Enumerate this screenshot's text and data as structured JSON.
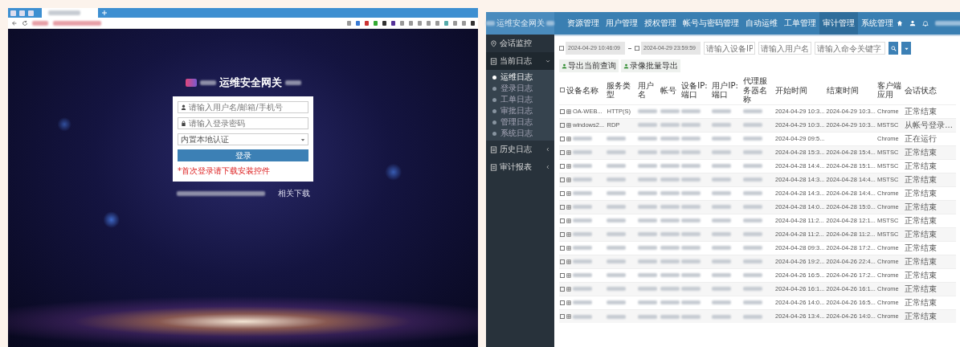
{
  "login_page": {
    "title": "运维安全网关",
    "username": {
      "placeholder": "请输入用户名/邮箱/手机号"
    },
    "password": {
      "placeholder": "请输入登录密码"
    },
    "auth_method": {
      "value": "内置本地认证"
    },
    "login_button": "登录",
    "notice": "*首次登录请下载安装控件",
    "download_link": "相关下载"
  },
  "app": {
    "brand": "运维安全网关",
    "menu": [
      {
        "label": "资源管理",
        "selected": false
      },
      {
        "label": "用户管理",
        "selected": false
      },
      {
        "label": "授权管理",
        "selected": false
      },
      {
        "label": "帐号与密码管理",
        "selected": false
      },
      {
        "label": "自动运维",
        "selected": false
      },
      {
        "label": "工单管理",
        "selected": false
      },
      {
        "label": "审计管理",
        "selected": true
      },
      {
        "label": "系统管理",
        "selected": false
      }
    ],
    "sidebar": [
      {
        "kind": "link",
        "label": "会话监控"
      },
      {
        "kind": "group",
        "label": "当前日志",
        "expanded": true,
        "children": [
          {
            "label": "运维日志",
            "selected": true
          },
          {
            "label": "登录日志",
            "selected": false
          },
          {
            "label": "工单日志",
            "selected": false
          },
          {
            "label": "审批日志",
            "selected": false
          },
          {
            "label": "管理日志",
            "selected": false
          },
          {
            "label": "系统日志",
            "selected": false
          }
        ]
      },
      {
        "kind": "group",
        "label": "历史日志",
        "expanded": false
      },
      {
        "kind": "group",
        "label": "审计报表",
        "expanded": false
      }
    ],
    "filters": {
      "start_time": "2024-04-29 10:46:09",
      "end_time": "2024-04-29 23:59:59",
      "device_ip": {
        "placeholder": "请输入设备IP"
      },
      "username": {
        "placeholder": "请输入用户名"
      },
      "command": {
        "placeholder": "请输入命令关键字"
      }
    },
    "export_buttons": [
      "导出当前查询",
      "录像批量导出"
    ],
    "table": {
      "select_all_checked": false,
      "columns": [
        "设备名称",
        "服务类型",
        "用户名",
        "帐号",
        "设备IP: 端口",
        "用户IP: 端口",
        "代理服务器名称",
        "开始时间",
        "结束时间",
        "客户端应用",
        "会话状态"
      ],
      "rows": [
        {
          "checked": false,
          "device": "OA-WEB...",
          "service": "HTTP(S)",
          "user": null,
          "account": null,
          "device_ip": null,
          "user_ip": null,
          "proxy": null,
          "start": "2024-04-29 10:3...",
          "end": "2024-04-29 10:3...",
          "client": "Chrome",
          "status": "正常结束"
        },
        {
          "checked": false,
          "device": "windows2...",
          "service": "RDP",
          "user": null,
          "account": null,
          "device_ip": null,
          "user_ip": null,
          "proxy": null,
          "start": "2024-04-29 10:3...",
          "end": "2024-04-29 10:3...",
          "client": "MSTSC",
          "status": "从帐号登录..."
        },
        {
          "checked": false,
          "device": null,
          "service": null,
          "user": null,
          "account": null,
          "device_ip": null,
          "user_ip": null,
          "proxy": null,
          "start": "2024-04-29 09:5...",
          "client": "Chrome",
          "status": "正在运行"
        },
        {
          "checked": false,
          "device": null,
          "service": null,
          "user": null,
          "account": null,
          "device_ip": null,
          "user_ip": null,
          "proxy": null,
          "start": "2024-04-28 15:3...",
          "end": "2024-04-28 15:4...",
          "client": "MSTSC",
          "status": "正常结束"
        },
        {
          "checked": false,
          "device": null,
          "service": null,
          "user": null,
          "account": null,
          "device_ip": null,
          "user_ip": null,
          "proxy": null,
          "start": "2024-04-28 14:4...",
          "end": "2024-04-28 15:1...",
          "client": "MSTSC",
          "status": "正常结束"
        },
        {
          "checked": false,
          "device": null,
          "service": null,
          "user": null,
          "account": null,
          "device_ip": null,
          "user_ip": null,
          "proxy": null,
          "start": "2024-04-28 14:3...",
          "end": "2024-04-28 14:4...",
          "client": "MSTSC",
          "status": "正常结束"
        },
        {
          "checked": false,
          "device": null,
          "service": null,
          "user": null,
          "account": null,
          "device_ip": null,
          "user_ip": null,
          "proxy": null,
          "start": "2024-04-28 14:3...",
          "end": "2024-04-28 14:4...",
          "client": "Chrome",
          "status": "正常结束"
        },
        {
          "checked": false,
          "device": null,
          "service": null,
          "user": null,
          "account": null,
          "device_ip": null,
          "user_ip": null,
          "proxy": null,
          "start": "2024-04-28 14:0...",
          "end": "2024-04-28 15:0...",
          "client": "Chrome",
          "status": "正常结束"
        },
        {
          "checked": false,
          "device": null,
          "service": null,
          "user": null,
          "account": null,
          "device_ip": null,
          "user_ip": null,
          "proxy": null,
          "start": "2024-04-28 11:2...",
          "end": "2024-04-28 12:1...",
          "client": "MSTSC",
          "status": "正常结束"
        },
        {
          "checked": false,
          "device": null,
          "service": null,
          "user": null,
          "account": null,
          "device_ip": null,
          "user_ip": null,
          "proxy": null,
          "start": "2024-04-28 11:2...",
          "end": "2024-04-28 11:2...",
          "client": "MSTSC",
          "status": "正常结束"
        },
        {
          "checked": false,
          "device": null,
          "service": null,
          "user": null,
          "account": null,
          "device_ip": null,
          "user_ip": null,
          "proxy": null,
          "start": "2024-04-28 09:3...",
          "end": "2024-04-28 17:2...",
          "client": "Chrome",
          "status": "正常结束"
        },
        {
          "checked": false,
          "device": null,
          "service": null,
          "user": null,
          "account": null,
          "device_ip": null,
          "user_ip": null,
          "proxy": null,
          "start": "2024-04-26 19:2...",
          "end": "2024-04-26 22:4...",
          "client": "Chrome",
          "status": "正常结束"
        },
        {
          "checked": false,
          "device": null,
          "service": null,
          "user": null,
          "account": null,
          "device_ip": null,
          "user_ip": null,
          "proxy": null,
          "start": "2024-04-26 16:5...",
          "end": "2024-04-26 17:2...",
          "client": "Chrome",
          "status": "正常结束"
        },
        {
          "checked": false,
          "device": null,
          "service": null,
          "user": null,
          "account": null,
          "device_ip": null,
          "user_ip": null,
          "proxy": null,
          "start": "2024-04-26 16:1...",
          "end": "2024-04-26 16:1...",
          "client": "Chrome",
          "status": "正常结束"
        },
        {
          "checked": false,
          "device": null,
          "service": null,
          "user": null,
          "account": null,
          "device_ip": null,
          "user_ip": null,
          "proxy": null,
          "start": "2024-04-26 14:0...",
          "end": "2024-04-26 16:5...",
          "client": "Chrome",
          "status": "正常结束"
        },
        {
          "checked": false,
          "device": null,
          "service": null,
          "user": null,
          "account": null,
          "device_ip": null,
          "user_ip": null,
          "proxy": null,
          "start": "2024-04-26 13:4...",
          "end": "2024-04-26 14:0...",
          "client": "Chrome",
          "status": "正常结束"
        }
      ]
    }
  }
}
